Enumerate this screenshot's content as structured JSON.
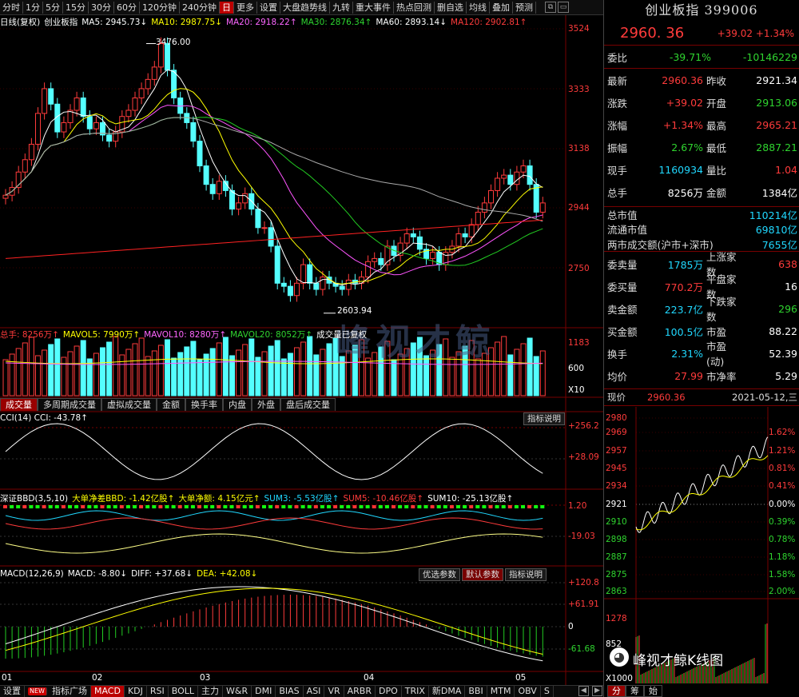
{
  "toolbar": {
    "items": [
      "分时",
      "1分",
      "5分",
      "15分",
      "30分",
      "60分",
      "120分钟",
      "240分钟",
      "日",
      "更多",
      "设置",
      "大盘趋势线",
      "九转",
      "重大事件",
      "热点回测",
      "删自选",
      "均线",
      "叠加",
      "预测"
    ],
    "active": "日"
  },
  "legend": {
    "period": "日线(复权)",
    "name": "创业板指",
    "ma5": "MA5: 2945.73↓",
    "ma10": "MA10: 2987.75↓",
    "ma20": "MA20: 2918.22↑",
    "ma30": "MA30: 2876.34↑",
    "ma60": "MA60: 2893.14↓",
    "ma120": "MA120: 2902.81↑"
  },
  "price_axis": [
    "3524",
    "3333",
    "3138",
    "2944",
    "2750"
  ],
  "annotations": {
    "high": "3476.00",
    "low": "2603.94"
  },
  "volume": {
    "legend_total": "总手: 8256万↑",
    "mavol5": "MAVOL5: 7990万↑",
    "mavol10": "MAVOL10: 8280万↑",
    "mavol20": "MAVOL20: 8052万↑",
    "note": "成交量已复权",
    "axis": [
      "1183",
      "600",
      "X10"
    ]
  },
  "vol_tabs": [
    "成交量",
    "多周期成交量",
    "虚拟成交量",
    "金额",
    "换手率",
    "内盘",
    "外盘",
    "盘后成交量"
  ],
  "cci": {
    "legend": "CCI(14)  CCI: -43.78↑",
    "axis": [
      "+256.2",
      "+28.09"
    ],
    "help": "指标说明"
  },
  "bbd": {
    "legend_a": "深证BBD(3,5,10)",
    "legend_b": "大单净差BBD: -1.42亿股↑",
    "legend_c": "大单净额: 4.15亿元↑",
    "legend_d": "SUM3: -5.53亿股↑",
    "legend_e": "SUM5: -10.46亿股↑",
    "legend_f": "SUM10: -25.13亿股↑",
    "axis": [
      "1.20",
      "-19.03"
    ]
  },
  "macd": {
    "legend_a": "MACD(12,26,9)",
    "legend_b": "MACD: -8.80↓",
    "legend_c": "DIFF: +37.68↓",
    "legend_d": "DEA: +42.08↓",
    "axis": [
      "+120.8",
      "+61.91",
      "0",
      "-61.68"
    ],
    "btn1": "优选参数",
    "btn2": "默认参数",
    "btn3": "指标说明"
  },
  "x_axis": [
    "01",
    "02",
    "03",
    "04",
    "05"
  ],
  "bottom_tabs": [
    "设置",
    "NEW",
    "指标广场",
    "MACD",
    "KDJ",
    "RSI",
    "BOLL",
    "主力",
    "W&R",
    "DMI",
    "BIAS",
    "ASI",
    "VR",
    "ARBR",
    "DPO",
    "TRIX",
    "新DMA",
    "BBI",
    "MTM",
    "OBV",
    "S"
  ],
  "bottom_active": "MACD",
  "quote": {
    "title": "创业板指 399006",
    "price": "2960. 36",
    "change": "+39.02",
    "pct": "+1.34%",
    "webi_label": "委比",
    "webi_v1": "-39.71%",
    "webi_v2": "-10146229",
    "rows": [
      {
        "l1": "最新",
        "v1": "2960.36",
        "c1": "red",
        "l2": "昨收",
        "v2": "2921.34",
        "c2": "white"
      },
      {
        "l1": "涨跌",
        "v1": "+39.02",
        "c1": "red",
        "l2": "开盘",
        "v2": "2913.06",
        "c2": "green"
      },
      {
        "l1": "涨幅",
        "v1": "+1.34%",
        "c1": "red",
        "l2": "最高",
        "v2": "2965.21",
        "c2": "red"
      },
      {
        "l1": "振幅",
        "v1": "2.67%",
        "c1": "green",
        "l2": "最低",
        "v2": "2887.21",
        "c2": "green"
      },
      {
        "l1": "现手",
        "v1": "1160934",
        "c1": "cyan",
        "l2": "量比",
        "v2": "1.04",
        "c2": "red"
      },
      {
        "l1": "总手",
        "v1": "8256万",
        "c1": "white",
        "l2": "金额",
        "v2": "1384亿",
        "c2": "white"
      }
    ],
    "mkt": [
      {
        "l": "总市值",
        "v": "110214亿"
      },
      {
        "l": "流通市值",
        "v": "69810亿"
      },
      {
        "l": "两市成交额(沪市+深市)",
        "v": "7655亿"
      }
    ],
    "rows2": [
      {
        "l1": "委卖量",
        "v1": "1785万",
        "c1": "cyan",
        "l2": "上涨家数",
        "v2": "638",
        "c2": "red"
      },
      {
        "l1": "委买量",
        "v1": "770.2万",
        "c1": "red",
        "l2": "平盘家数",
        "v2": "16",
        "c2": "white"
      },
      {
        "l1": "卖金额",
        "v1": "223.7亿",
        "c1": "cyan",
        "l2": "下跌家数",
        "v2": "296",
        "c2": "green"
      },
      {
        "l1": "买金额",
        "v1": "100.5亿",
        "c1": "cyan",
        "l2": "市盈",
        "v2": "88.22",
        "c2": "white"
      },
      {
        "l1": "换手",
        "v1": "2.31%",
        "c1": "cyan",
        "l2": "市盈(动)",
        "v2": "52.39",
        "c2": "white"
      },
      {
        "l1": "均价",
        "v1": "27.99",
        "c1": "red",
        "l2": "市净率",
        "v2": "5.29",
        "c2": "white"
      }
    ],
    "now_label": "现价",
    "now_price": "2960.36",
    "date": "2021-05-12,三"
  },
  "intraday": {
    "left_axis": [
      "2980",
      "2969",
      "2957",
      "2945",
      "2934",
      "2921",
      "2910",
      "2898",
      "2887",
      "2875",
      "2863"
    ],
    "right_axis": [
      "1.62%",
      "1.21%",
      "0.81%",
      "0.41%",
      "0.00%",
      "0.39%",
      "0.78%",
      "1.18%",
      "1.58%",
      "2.00%"
    ],
    "vol_axis": [
      "1278",
      "852",
      "X1000"
    ],
    "tabs": [
      "分",
      "筹",
      "始"
    ]
  },
  "watermark": "峰视才鲸",
  "wechat": "峰视才鲸K线图"
}
